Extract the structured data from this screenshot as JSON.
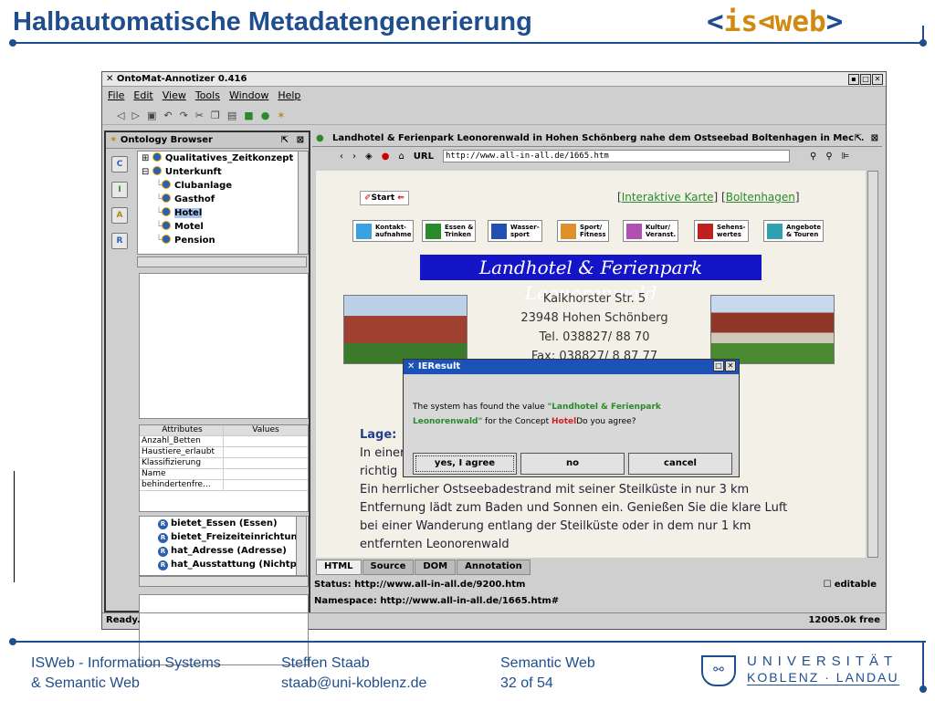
{
  "slide": {
    "title": "Halbautomatische Metadatengenerierung",
    "logo_open": "<",
    "logo_is": "is",
    "logo_web": "web",
    "logo_close": ">"
  },
  "app": {
    "title": "OntoMat-Annotizer 0.416",
    "menu": [
      "File",
      "Edit",
      "View",
      "Tools",
      "Window",
      "Help"
    ],
    "ontology_browser": "Ontology Browser",
    "tree": [
      {
        "label": "Qualitatives_Zeitkonzept",
        "indent": 0,
        "exp": "⊞"
      },
      {
        "label": "Unterkunft",
        "indent": 0,
        "exp": "⊟"
      },
      {
        "label": "Clubanlage",
        "indent": 1
      },
      {
        "label": "Gasthof",
        "indent": 1
      },
      {
        "label": "Hotel",
        "indent": 1,
        "selected": true
      },
      {
        "label": "Motel",
        "indent": 1
      },
      {
        "label": "Pension",
        "indent": 1
      }
    ],
    "attr_header": [
      "Attributes",
      "Values"
    ],
    "attrs": [
      "Anzahl_Betten",
      "Haustiere_erlaubt",
      "Klassifizierung",
      "Name",
      "behindertenfre..."
    ],
    "props": [
      "bietet_Essen (Essen)",
      "bietet_Freizeiteinrichtung",
      "hat_Adresse (Adresse)",
      "hat_Ausstattung (Nichtpri"
    ],
    "page_title": "Landhotel & Ferienpark Leonorenwald in Hohen Schönberg nahe dem Ostseebad Boltenhagen in Mec...",
    "url_label": "URL",
    "url": "http://www.all-in-all.de/1665.htm",
    "web": {
      "start": "Start",
      "links": [
        "[",
        "Interaktive Karte",
        "] [",
        "Boltenhagen",
        "]"
      ],
      "navs": [
        {
          "l1": "Kontakt-",
          "l2": "aufnahme",
          "color": "#3aa0e0"
        },
        {
          "l1": "Essen &",
          "l2": "Trinken",
          "color": "#2a8a2a"
        },
        {
          "l1": "Wasser-",
          "l2": "sport",
          "color": "#2050b0"
        },
        {
          "l1": "Sport/",
          "l2": "Fitness",
          "color": "#e0902a"
        },
        {
          "l1": "Kultur/",
          "l2": "Veranst.",
          "color": "#b050b0"
        },
        {
          "l1": "Sehens-",
          "l2": "wertes",
          "color": "#c02020"
        },
        {
          "l1": "Angebote",
          "l2": "& Touren",
          "color": "#30a0b0"
        }
      ],
      "hotel_name": "Landhotel & Ferienpark Leonorenwald",
      "address": [
        "Kalkhorster Str. 5",
        "23948 Hohen Schönberg",
        "Tel. 038827/ 88 70",
        "Fax: 038827/ 8 87 77"
      ],
      "lage": "Lage:",
      "text": [
        "In einer ... al so",
        "richtig",
        "Ein herrlicher Ostseebadestrand mit seiner Steilküste in nur 3 km",
        "Entfernung lädt zum Baden und Sonnen ein. Genießen Sie die klare Luft",
        "bei einer Wanderung entlang der Steilküste oder in dem nur 1 km",
        "entfernten Leonorenwald"
      ]
    },
    "tabs": [
      "HTML",
      "Source",
      "DOM",
      "Annotation"
    ],
    "status": "Status: http://www.all-in-all.de/9200.htm",
    "namespace": "Namespace: http://www.all-in-all.de/1665.htm#",
    "editable": "editable",
    "ready": "Ready.",
    "memory": "12005.0k free"
  },
  "dialog": {
    "title": "IEResult",
    "msg_pre": "The system has found the value ",
    "value": "\"Landhotel & Ferienpark Leonorenwald\"",
    "msg_mid": " for the Concept ",
    "concept": "Hotel",
    "msg_post": "Do you agree?",
    "buttons": [
      "yes, I agree",
      "no",
      "cancel"
    ]
  },
  "footer": {
    "col1": [
      "ISWeb - Information Systems",
      "& Semantic Web"
    ],
    "col2": [
      "Steffen Staab",
      "staab@uni-koblenz.de"
    ],
    "col3": [
      "Semantic Web",
      "32 of 54"
    ],
    "uni1": "UNIVERSITÄT",
    "uni2": "KOBLENZ · LANDAU"
  }
}
